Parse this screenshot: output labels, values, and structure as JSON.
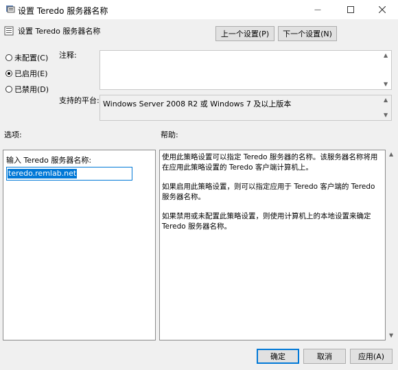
{
  "window": {
    "title": "设置 Teredo 服务器名称",
    "minimize_glyph": "—",
    "maximize_glyph": "☐",
    "close_glyph": "✕"
  },
  "header": {
    "title": "设置 Teredo 服务器名称",
    "prev_button": "上一个设置(P)",
    "next_button": "下一个设置(N)"
  },
  "state": {
    "options": [
      {
        "label": "未配置(C)",
        "checked": false
      },
      {
        "label": "已启用(E)",
        "checked": true
      },
      {
        "label": "已禁用(D)",
        "checked": false
      }
    ]
  },
  "comment": {
    "label": "注释:",
    "value": ""
  },
  "platform": {
    "label": "支持的平台:",
    "value": "Windows Server 2008 R2 或 Windows 7 及以上版本"
  },
  "options_section": {
    "label": "选项:",
    "field_label": "输入 Teredo 服务器名称:",
    "field_value": "teredo.remlab.net"
  },
  "help_section": {
    "label": "帮助:",
    "paragraphs": [
      "使用此策略设置可以指定 Teredo 服务器的名称。该服务器名称将用在应用此策略设置的 Teredo 客户端计算机上。",
      "如果启用此策略设置，则可以指定应用于 Teredo 客户端的 Teredo 服务器名称。",
      "如果禁用或未配置此策略设置，则使用计算机上的本地设置来确定 Teredo 服务器名称。"
    ]
  },
  "footer": {
    "ok_button": "确定",
    "cancel_button": "取消",
    "apply_button": "应用(A)"
  },
  "colors": {
    "accent": "#0078d7",
    "window_bg": "#f0f0f0"
  }
}
